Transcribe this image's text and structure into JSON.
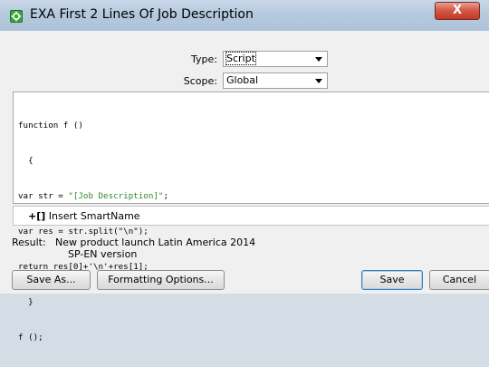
{
  "window": {
    "title": "EXA First 2 Lines Of Job Description",
    "close_glyph": "X"
  },
  "form": {
    "type_label": "Type:",
    "type_value": "Script",
    "scope_label": "Scope:",
    "scope_value": "Global"
  },
  "editor": {
    "lines": [
      "function f ()",
      "  {",
      "var str = \"[Job Description]\";",
      "var res = str.split(\"\\n\");",
      "return res[0]+'\\n'+res[1];",
      "  }",
      "f ();"
    ],
    "string_color": "#2a8a2a"
  },
  "insert": {
    "prefix": "+",
    "brackets": "[]",
    "label": "Insert SmartName"
  },
  "result": {
    "label": "Result:",
    "value": "New product launch Latin America 2014\n    SP-EN version"
  },
  "buttons": {
    "save_as": "Save As...",
    "formatting": "Formatting Options...",
    "save": "Save",
    "cancel": "Cancel"
  },
  "colors": {
    "titlebar": "#b5c9de",
    "close_button": "#d45b46",
    "window_bg": "#f0f0f0",
    "app_icon": "#3aa53a"
  },
  "icons": {
    "app": "gear-icon",
    "close": "close-icon"
  }
}
